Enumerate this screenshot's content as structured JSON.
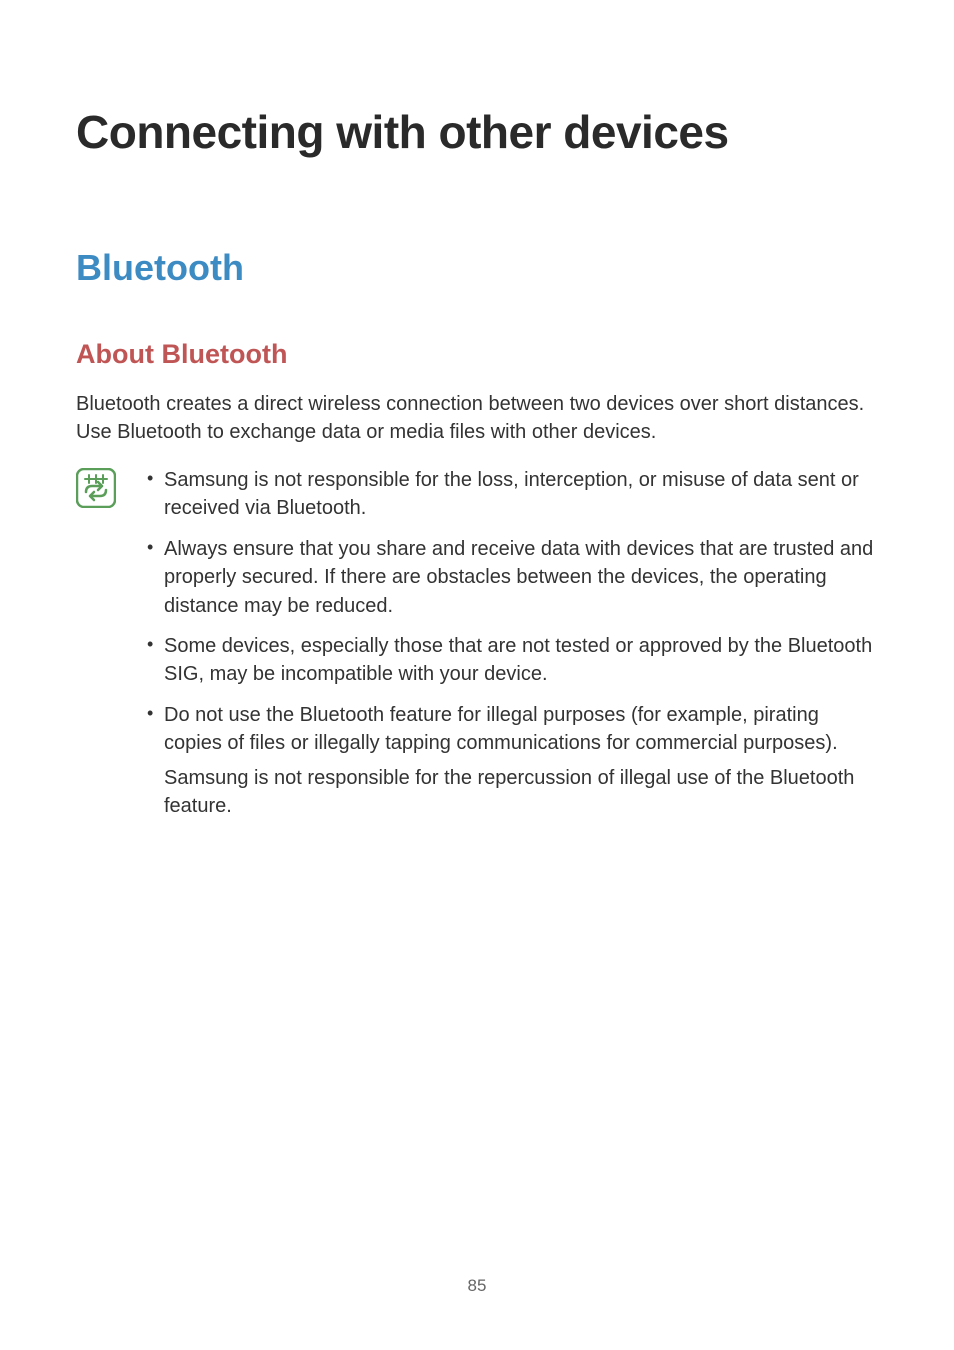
{
  "title": "Connecting with other devices",
  "section": {
    "heading": "Bluetooth",
    "subheading": "About Bluetooth",
    "intro": "Bluetooth creates a direct wireless connection between two devices over short distances. Use Bluetooth to exchange data or media files with other devices.",
    "notes": [
      {
        "text": "Samsung is not responsible for the loss, interception, or misuse of data sent or received via Bluetooth."
      },
      {
        "text": "Always ensure that you share and receive data with devices that are trusted and properly secured. If there are obstacles between the devices, the operating distance may be reduced."
      },
      {
        "text": "Some devices, especially those that are not tested or approved by the Bluetooth SIG, may be incompatible with your device."
      },
      {
        "text": "Do not use the Bluetooth feature for illegal purposes (for example, pirating copies of files or illegally tapping communications for commercial purposes).",
        "sub": "Samsung is not responsible for the repercussion of illegal use of the Bluetooth feature."
      }
    ]
  },
  "pageNumber": "85"
}
